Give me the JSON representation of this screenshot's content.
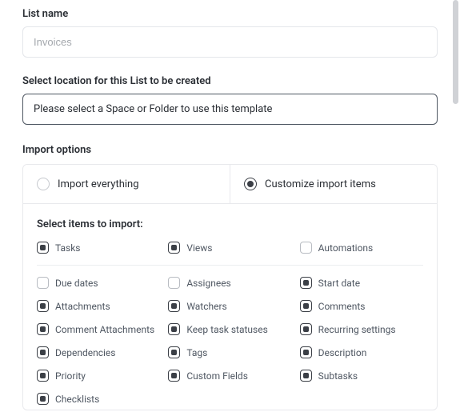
{
  "listName": {
    "label": "List name",
    "placeholder": "Invoices",
    "value": ""
  },
  "location": {
    "label": "Select location for this List to be created",
    "placeholder": "Please select a Space or Folder to use this template"
  },
  "importOptions": {
    "label": "Import options",
    "radios": [
      {
        "label": "Import everything",
        "selected": false
      },
      {
        "label": "Customize import items",
        "selected": true
      }
    ],
    "selectTitle": "Select items to import:",
    "topItems": [
      {
        "label": "Tasks",
        "checked": true
      },
      {
        "label": "Views",
        "checked": true
      },
      {
        "label": "Automations",
        "checked": false
      }
    ],
    "items": [
      {
        "label": "Due dates",
        "checked": false
      },
      {
        "label": "Assignees",
        "checked": false
      },
      {
        "label": "Start date",
        "checked": true
      },
      {
        "label": "Attachments",
        "checked": true
      },
      {
        "label": "Watchers",
        "checked": true
      },
      {
        "label": "Comments",
        "checked": true
      },
      {
        "label": "Comment Attachments",
        "checked": true
      },
      {
        "label": "Keep task statuses",
        "checked": true
      },
      {
        "label": "Recurring settings",
        "checked": true
      },
      {
        "label": "Dependencies",
        "checked": true
      },
      {
        "label": "Tags",
        "checked": true
      },
      {
        "label": "Description",
        "checked": true
      },
      {
        "label": "Priority",
        "checked": true
      },
      {
        "label": "Custom Fields",
        "checked": true
      },
      {
        "label": "Subtasks",
        "checked": true
      },
      {
        "label": "Checklists",
        "checked": true
      }
    ]
  }
}
